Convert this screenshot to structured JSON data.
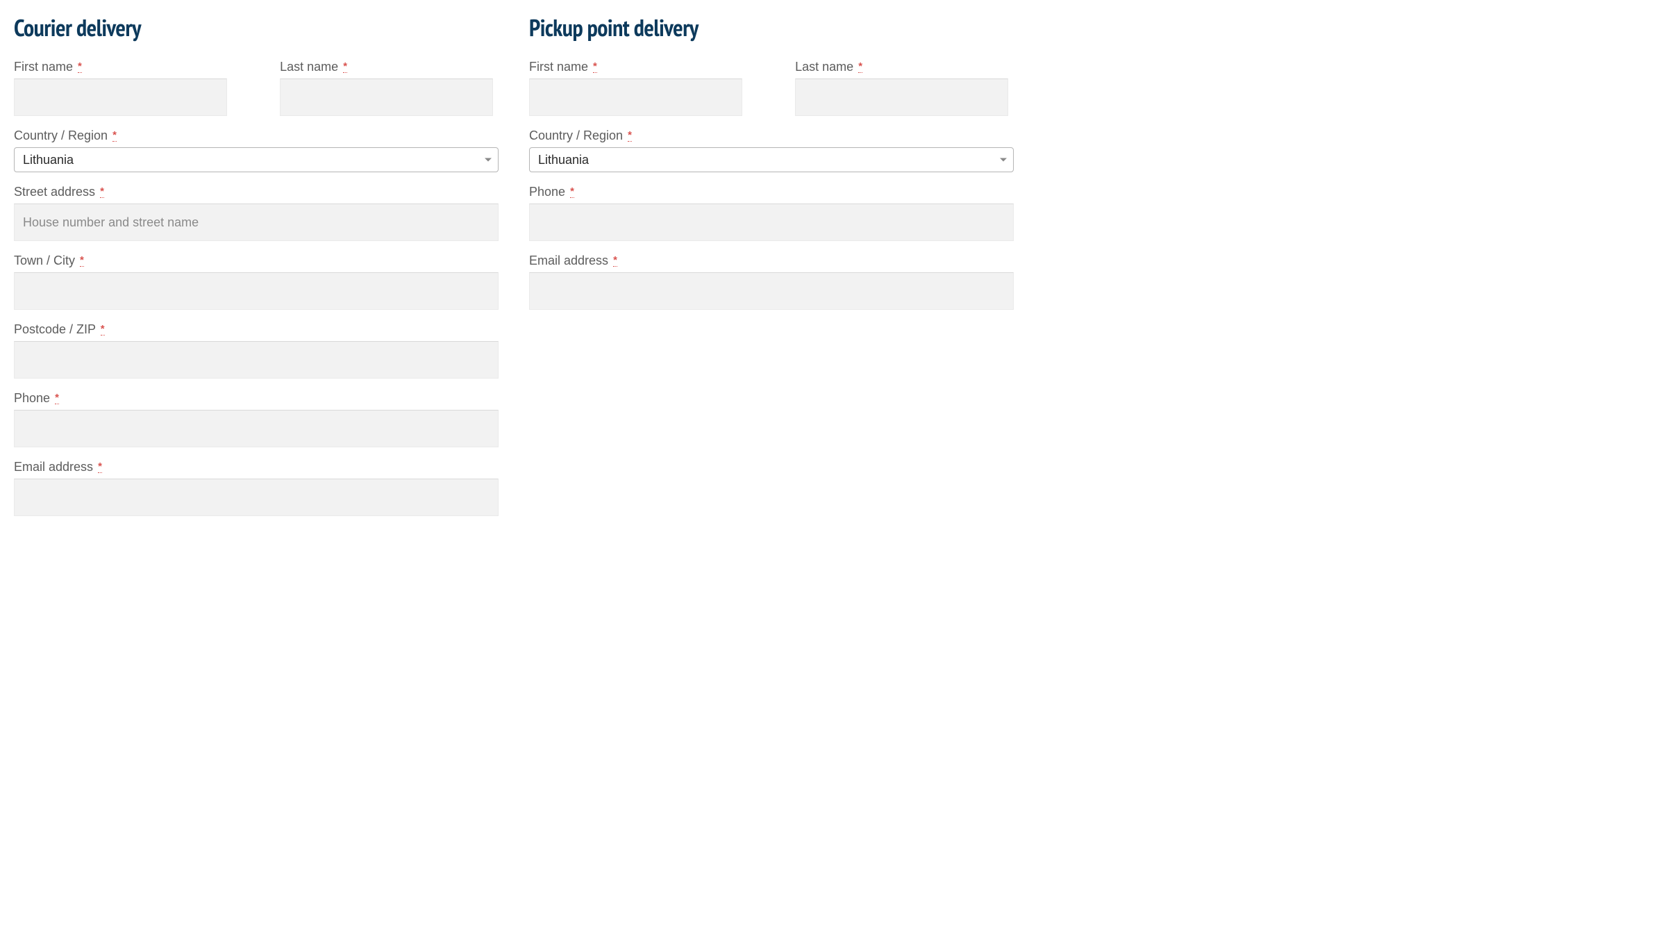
{
  "required_marker": "*",
  "courier": {
    "title": "Courier delivery",
    "first_name": {
      "label": "First name",
      "value": ""
    },
    "last_name": {
      "label": "Last name",
      "value": ""
    },
    "country": {
      "label": "Country / Region",
      "selected": "Lithuania"
    },
    "street": {
      "label": "Street address",
      "placeholder": "House number and street name",
      "value": ""
    },
    "city": {
      "label": "Town / City",
      "value": ""
    },
    "postcode": {
      "label": "Postcode / ZIP",
      "value": ""
    },
    "phone": {
      "label": "Phone",
      "value": ""
    },
    "email": {
      "label": "Email address",
      "value": ""
    }
  },
  "pickup": {
    "title": "Pickup point delivery",
    "first_name": {
      "label": "First name",
      "value": ""
    },
    "last_name": {
      "label": "Last name",
      "value": ""
    },
    "country": {
      "label": "Country / Region",
      "selected": "Lithuania"
    },
    "phone": {
      "label": "Phone",
      "value": ""
    },
    "email": {
      "label": "Email address",
      "value": ""
    }
  }
}
